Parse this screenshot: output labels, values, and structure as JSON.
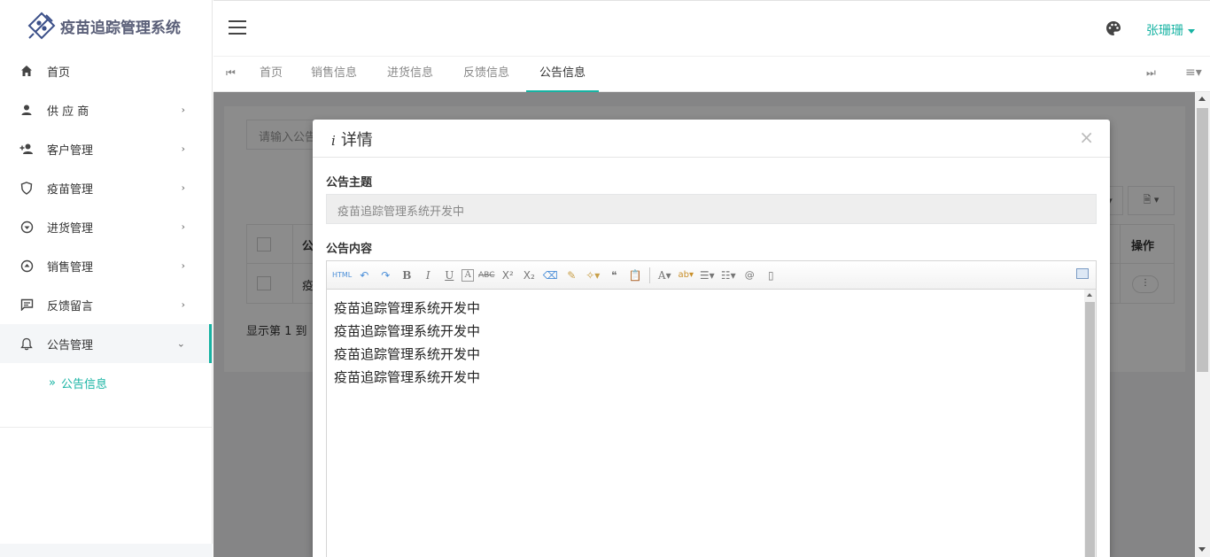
{
  "app": {
    "logo_text": "疫苗追踪管理系统",
    "accent_color": "#17b3a3"
  },
  "sidebar": {
    "items": [
      {
        "label": "首页",
        "icon": "home-icon"
      },
      {
        "label": "供 应 商",
        "icon": "person-icon",
        "has_arrow": true
      },
      {
        "label": "客户管理",
        "icon": "add-user-icon",
        "has_arrow": true
      },
      {
        "label": "疫苗管理",
        "icon": "shield-icon",
        "has_arrow": true
      },
      {
        "label": "进货管理",
        "icon": "download-circle-icon",
        "has_arrow": true
      },
      {
        "label": "销售管理",
        "icon": "upload-circle-icon",
        "has_arrow": true
      },
      {
        "label": "反馈留言",
        "icon": "message-icon",
        "has_arrow": true
      },
      {
        "label": "公告管理",
        "icon": "bell-icon",
        "has_arrow": true,
        "expanded": true
      }
    ],
    "sub_item": {
      "label": "公告信息",
      "prefix": "»"
    }
  },
  "header": {
    "user_name": "张珊珊"
  },
  "tabs": {
    "items": [
      "首页",
      "销售信息",
      "进货信息",
      "反馈信息",
      "公告信息"
    ],
    "active": "公告信息"
  },
  "background_page": {
    "search_placeholder": "请输入公告",
    "table_header_partial": "公",
    "row_partial": "疫",
    "operation_header": "操作",
    "operation_button": "⋮",
    "footer_partial": "显示第 1 到"
  },
  "modal": {
    "title": "详情",
    "title_icon": "info-icon",
    "close": "×",
    "subject_label": "公告主题",
    "subject_value": "疫苗追踪管理系统开发中",
    "content_label": "公告内容",
    "content_lines": [
      "疫苗追踪管理系统开发中",
      "疫苗追踪管理系统开发中",
      "疫苗追踪管理系统开发中",
      "疫苗追踪管理系统开发中"
    ],
    "toolbar": {
      "html_label": "HTML",
      "bold": "B",
      "italic": "I",
      "underline": "U",
      "font_border": "A",
      "strike": "ABC",
      "sup": "X²",
      "sub": "X₂",
      "quote": "❝",
      "font_color": "A",
      "backcolor": "ab",
      "at": "@"
    }
  }
}
